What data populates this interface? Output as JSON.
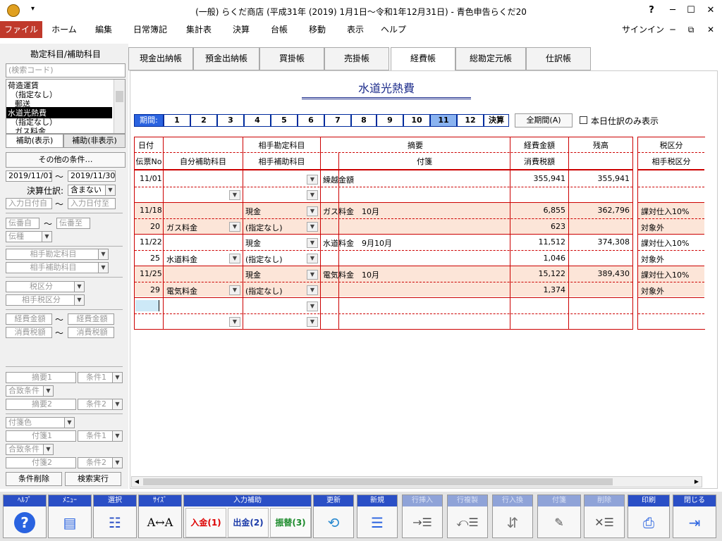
{
  "window": {
    "title": "(一般) らくだ商店 (平成31年 (2019) 1月1日～令和1年12月31日) - 青色申告らくだ20",
    "help": "?",
    "signin": "サインイン"
  },
  "menu": [
    "ファイル",
    "ホーム",
    "編集",
    "日常簿記",
    "集計表",
    "決算",
    "台帳",
    "移動",
    "表示",
    "ヘルプ"
  ],
  "left": {
    "header": "勘定科目/補助科目",
    "search_placeholder": "(検索コード)",
    "accounts": [
      "荷造運賃",
      "（指定なし）",
      "郵送",
      "水道光熱費",
      "（指定なし）",
      "ガス料金"
    ],
    "sub_tabs": [
      "補助(表示)",
      "補助(非表示)"
    ],
    "other_conditions": "その他の条件…",
    "date_from": "2019/11/01",
    "date_to": "2019/11/30",
    "tilde": "～",
    "closing_label": "決算仕訳:",
    "closing_value": "含まない",
    "input_date_from": "入力日付自",
    "input_date_to": "入力日付至",
    "slip_from": "伝番自",
    "slip_to": "伝番至",
    "slip_type": "伝種",
    "partner_account": "相手勘定科目",
    "partner_sub": "相手補助科目",
    "tax_class": "税区分",
    "partner_tax": "相手税区分",
    "expense_from": "経費金額",
    "expense_to": "経費金額",
    "tax_from": "消費税額",
    "tax_to": "消費税額",
    "summary1": "摘要1",
    "cond1": "条件1",
    "match_cond": "合致条件",
    "summary2": "摘要2",
    "cond2": "条件2",
    "tag_color": "付箋色",
    "tag1": "付箋1",
    "tag_cond1": "条件1",
    "match_cond2": "合致条件",
    "tag2": "付箋2",
    "tag_cond2": "条件2",
    "clear": "条件削除",
    "search": "検索実行"
  },
  "tabs": [
    "現金出納帳",
    "預金出納帳",
    "買掛帳",
    "売掛帳",
    "経費帳",
    "総勘定元帳",
    "仕訳帳"
  ],
  "ledger": {
    "title": "水道光熱費",
    "period_label": "期間:",
    "periods": [
      "1",
      "2",
      "3",
      "4",
      "5",
      "6",
      "7",
      "8",
      "9",
      "10",
      "11",
      "12",
      "決算"
    ],
    "all_period_btn": "全期間(A)",
    "today_only": "本日仕訳のみ表示",
    "headers": {
      "date": "日付",
      "slip": "伝票No",
      "own_sub": "自分補助科目",
      "partner_acct": "相手勘定科目",
      "partner_sub": "相手補助科目",
      "summary": "摘要",
      "tag": "付箋",
      "amount": "経費金額",
      "tax": "消費税額",
      "balance": "残高",
      "tax_class": "税区分",
      "partner_tax": "相手税区分"
    },
    "rows": [
      {
        "date": "11/01",
        "slip": "",
        "own": "",
        "partner": "",
        "partner_sub": "",
        "summary": "繰越金額",
        "amount": "355,941",
        "tax": "",
        "balance": "355,941",
        "taxc": "",
        "ptax": "",
        "hl": false
      },
      {
        "date": "11/18",
        "slip": "20",
        "own": "ガス料金",
        "partner": "現金",
        "partner_sub": "(指定なし)",
        "summary": "ガス料金　10月",
        "amount": "6,855",
        "tax": "623",
        "balance": "362,796",
        "taxc": "課対仕入10%",
        "ptax": "対象外",
        "hl": true
      },
      {
        "date": "11/22",
        "slip": "25",
        "own": "水道料金",
        "partner": "現金",
        "partner_sub": "(指定なし)",
        "summary": "水道料金　9月10月",
        "amount": "11,512",
        "tax": "1,046",
        "balance": "374,308",
        "taxc": "課対仕入10%",
        "ptax": "対象外",
        "hl": false
      },
      {
        "date": "11/25",
        "slip": "29",
        "own": "電気料金",
        "partner": "現金",
        "partner_sub": "(指定なし)",
        "summary": "電気料金　10月",
        "amount": "15,122",
        "tax": "1,374",
        "balance": "389,430",
        "taxc": "課対仕入10%",
        "ptax": "対象外",
        "hl": true
      }
    ]
  },
  "toolbar": [
    {
      "label": "ﾍﾙﾌﾟ",
      "icon": "?",
      "enabled": true
    },
    {
      "label": "ﾒﾆｭｰ",
      "icon": "▤",
      "enabled": true
    },
    {
      "label": "選択",
      "icon": "☷",
      "enabled": true
    },
    {
      "label": "ｻｲｽﾞ",
      "icon": "A↔A",
      "enabled": true
    },
    {
      "label": "更新",
      "icon": "⟲",
      "enabled": true
    },
    {
      "label": "新規",
      "icon": "☰",
      "enabled": true
    },
    {
      "label": "行挿入",
      "icon": "→☰",
      "enabled": false
    },
    {
      "label": "行複製",
      "icon": "⤺☰",
      "enabled": false
    },
    {
      "label": "行入換",
      "icon": "⇵",
      "enabled": false
    },
    {
      "label": "付箋",
      "icon": "✎",
      "enabled": false
    },
    {
      "label": "削除",
      "icon": "✕☰",
      "enabled": false
    },
    {
      "label": "印刷",
      "icon": "⎙",
      "enabled": true
    },
    {
      "label": "閉じる",
      "icon": "⇥",
      "enabled": true
    }
  ],
  "input_assist": {
    "label": "入力補助",
    "in": "入金(1)",
    "out": "出金(2)",
    "transfer": "振替(3)"
  },
  "colors": {
    "accent": "#2a4fc6",
    "file_menu": "#c0392b",
    "grid_line": "#cc0000",
    "highlight_row": "#fce5d8"
  }
}
